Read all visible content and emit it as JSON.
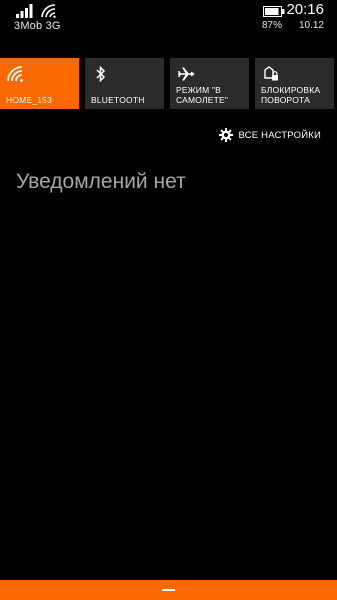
{
  "status_bar": {
    "carrier": "3Mob 3G",
    "battery_percent": "87%",
    "time": "20:16",
    "date": "10.12",
    "icons": [
      "signal-icon",
      "wifi-icon",
      "battery-icon"
    ]
  },
  "quick_actions": [
    {
      "label": "HOME_153",
      "icon": "wifi-icon",
      "active": true
    },
    {
      "label": "BLUETOOTH",
      "icon": "bluetooth-icon",
      "active": false
    },
    {
      "label": "РЕЖИМ \"В САМОЛЕТЕ\"",
      "icon": "airplane-icon",
      "active": false
    },
    {
      "label": "БЛОКИРОВКА ПОВОРОТА",
      "icon": "rotation-lock-icon",
      "active": false
    }
  ],
  "all_settings": {
    "label": "ВСЕ НАСТРОЙКИ",
    "icon": "gear-icon"
  },
  "notifications": {
    "empty_text": "Уведомлений нет"
  },
  "colors": {
    "accent": "#fa6800",
    "tile_inactive": "#2b2b2b",
    "background": "#000000",
    "muted_text": "#a6a6a6"
  }
}
